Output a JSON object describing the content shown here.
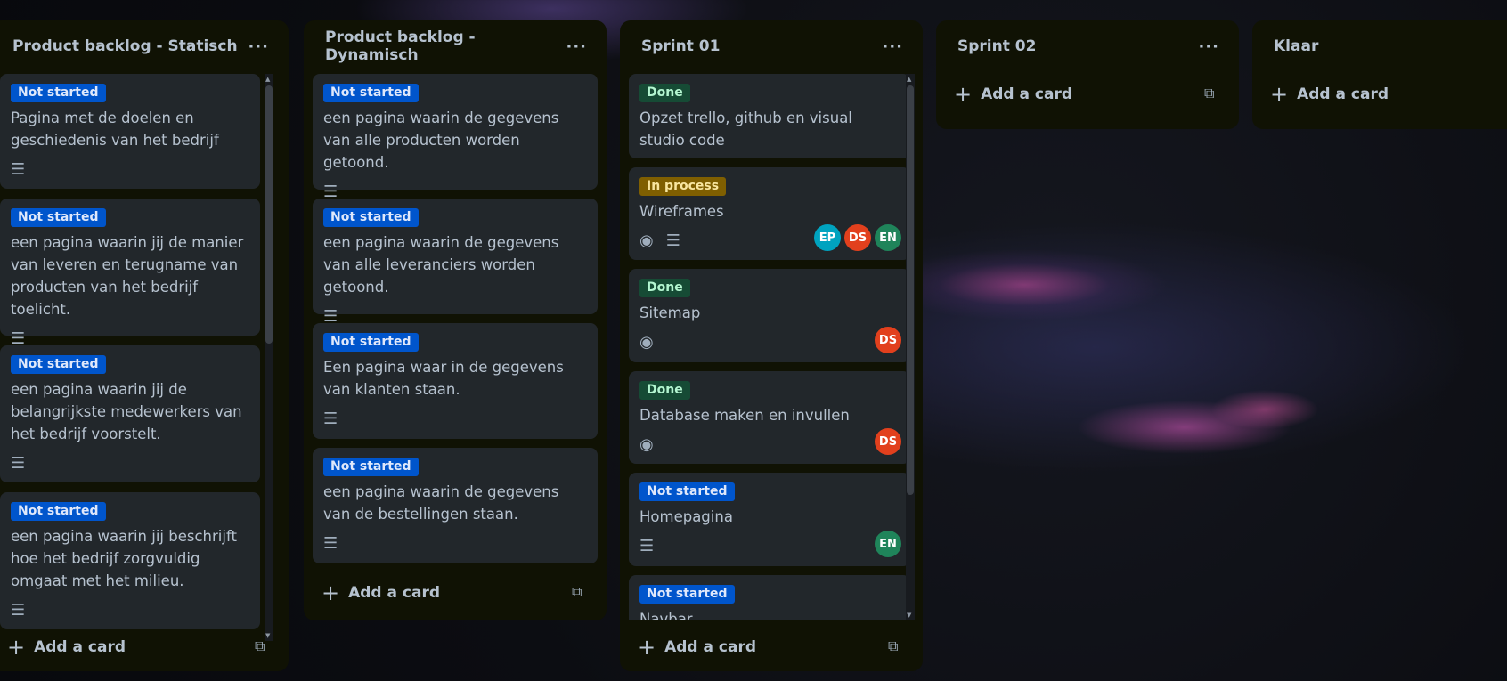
{
  "colors": {
    "list_bg": "#101204",
    "card_bg": "#22272b",
    "not_started": "#0055cc",
    "done": "#164b35",
    "in_process": "#7f5f01",
    "avatar_ep": "#00a3bf",
    "avatar_ds": "#e2401d",
    "avatar_en": "#1f845a"
  },
  "lists": [
    {
      "title": "Product backlog - Statisch",
      "menu_icon": "more-icon",
      "add_label": "Add a card",
      "cards": [
        {
          "label": "Not started",
          "title": "Pagina met de doelen en geschiedenis van het bedrijf"
        },
        {
          "label": "Not started",
          "title": "een pagina waarin jij de manier van leveren en terugname van producten van het bedrijf toelicht."
        },
        {
          "label": "Not started",
          "title": "een pagina waarin jij de belangrijkste medewerkers van het bedrijf voorstelt."
        },
        {
          "label": "Not started",
          "title": "een pagina waarin jij beschrijft hoe het bedrijf zorgvuldig omgaat met het milieu."
        }
      ]
    },
    {
      "title": "Product backlog - Dynamisch",
      "menu_icon": "more-icon",
      "add_label": "Add a card",
      "cards": [
        {
          "label": "Not started",
          "title": "een pagina waarin de gegevens van alle producten worden getoond."
        },
        {
          "label": "Not started",
          "title": "een pagina waarin de gegevens van alle leveranciers worden getoond."
        },
        {
          "label": "Not started",
          "title": "Een pagina waar in de gegevens van klanten staan."
        },
        {
          "label": "Not started",
          "title": "een pagina waarin de gegevens van de bestellingen staan."
        }
      ]
    },
    {
      "title": "Sprint 01",
      "menu_icon": "more-icon",
      "add_label": "Add a card",
      "cards": [
        {
          "label": "Done",
          "title": "Opzet trello, github en visual studio code"
        },
        {
          "label": "In process",
          "title": "Wireframes",
          "members": [
            "EP",
            "DS",
            "EN"
          ]
        },
        {
          "label": "Done",
          "title": "Sitemap",
          "members": [
            "DS"
          ]
        },
        {
          "label": "Done",
          "title": "Database maken en invullen",
          "members": [
            "DS"
          ]
        },
        {
          "label": "Not started",
          "title": "Homepagina",
          "members": [
            "EN"
          ]
        },
        {
          "label": "Not started",
          "title": "Navbar"
        }
      ]
    },
    {
      "title": "Sprint 02",
      "menu_icon": "more-icon",
      "add_label": "Add a card"
    },
    {
      "title": "Klaar",
      "add_label": "Add a card"
    }
  ]
}
